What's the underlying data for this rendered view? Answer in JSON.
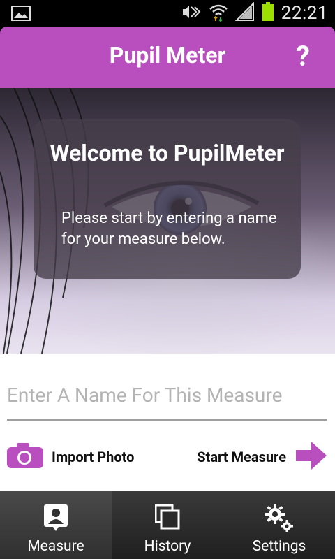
{
  "status_bar": {
    "time": "22:21"
  },
  "header": {
    "title": "Pupil Meter",
    "help_label": "?"
  },
  "welcome": {
    "title": "Welcome to PupilMeter",
    "message": "Please start by entering a name for your measure below."
  },
  "measure_form": {
    "name_input": {
      "placeholder": "Enter A Name For This Measure",
      "value": ""
    },
    "import_label": "Import Photo",
    "start_label": "Start Measure"
  },
  "bottom_nav": {
    "items": [
      {
        "label": "Measure",
        "icon": "person-id-icon",
        "active": true
      },
      {
        "label": "History",
        "icon": "copy-stack-icon",
        "active": false
      },
      {
        "label": "Settings",
        "icon": "gears-icon",
        "active": false
      }
    ]
  },
  "colors": {
    "brand": "#b94fbf",
    "nav_bg": "#2a2a2a"
  }
}
